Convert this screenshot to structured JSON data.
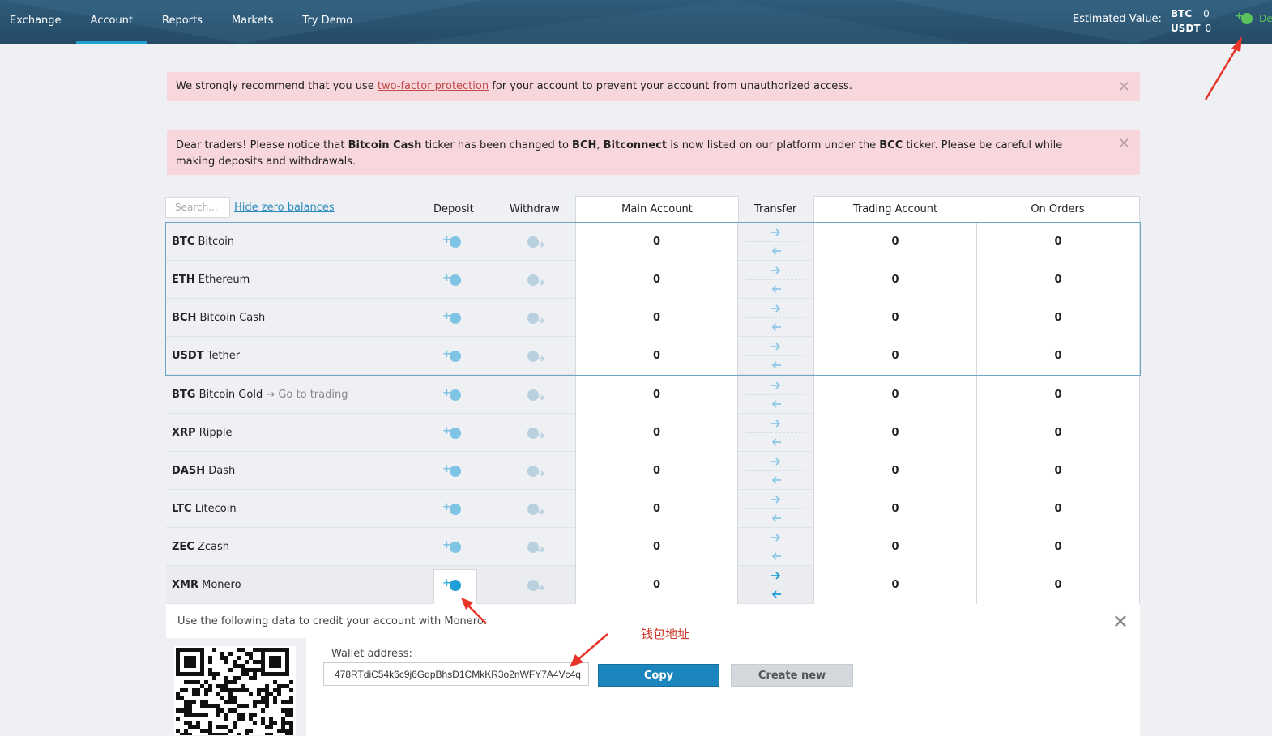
{
  "nav": {
    "items": [
      {
        "label": "Exchange",
        "active": false
      },
      {
        "label": "Account",
        "active": true
      },
      {
        "label": "Reports",
        "active": false
      },
      {
        "label": "Markets",
        "active": false
      },
      {
        "label": "Try Demo",
        "active": false
      }
    ],
    "estimated_label": "Estimated Value:",
    "btc_label": "BTC",
    "btc_value": "0",
    "usdt_label": "USDT",
    "usdt_value": "0",
    "deposit_partial": "De"
  },
  "alerts": {
    "a1_before": "We strongly recommend that you use ",
    "a1_link": "two-factor protection",
    "a1_after": " for your account to prevent your account from unauthorized access.",
    "a2_p1": "Dear traders! Please notice that ",
    "a2_b1": "Bitcoin Cash",
    "a2_p2": " ticker has been changed to ",
    "a2_b2": "BCH",
    "a2_p3": ", ",
    "a2_b3": "Bitconnect",
    "a2_p4": " is now listed on our platform under the ",
    "a2_b4": "BCC",
    "a2_p5": " ticker. Please be careful while making deposits and withdrawals.",
    "close": "✕"
  },
  "table": {
    "search_placeholder": "Search...",
    "hide_zero": "Hide zero balances",
    "headers": {
      "deposit": "Deposit",
      "withdraw": "Withdraw",
      "main": "Main Account",
      "transfer": "Transfer",
      "trading": "Trading Account",
      "orders": "On Orders"
    },
    "rows": [
      {
        "ticker": "BTC",
        "name": "Bitcoin",
        "extra": "",
        "main": "0",
        "trading": "0",
        "orders": "0"
      },
      {
        "ticker": "ETH",
        "name": "Ethereum",
        "extra": "",
        "main": "0",
        "trading": "0",
        "orders": "0"
      },
      {
        "ticker": "BCH",
        "name": "Bitcoin Cash",
        "extra": "",
        "main": "0",
        "trading": "0",
        "orders": "0"
      },
      {
        "ticker": "USDT",
        "name": "Tether",
        "extra": "",
        "main": "0",
        "trading": "0",
        "orders": "0"
      },
      {
        "ticker": "BTG",
        "name": "Bitcoin Gold",
        "extra": " → Go to trading",
        "main": "0",
        "trading": "0",
        "orders": "0"
      },
      {
        "ticker": "XRP",
        "name": "Ripple",
        "extra": "",
        "main": "0",
        "trading": "0",
        "orders": "0"
      },
      {
        "ticker": "DASH",
        "name": "Dash",
        "extra": "",
        "main": "0",
        "trading": "0",
        "orders": "0"
      },
      {
        "ticker": "LTC",
        "name": "Litecoin",
        "extra": "",
        "main": "0",
        "trading": "0",
        "orders": "0"
      },
      {
        "ticker": "ZEC",
        "name": "Zcash",
        "extra": "",
        "main": "0",
        "trading": "0",
        "orders": "0"
      },
      {
        "ticker": "XMR",
        "name": "Monero",
        "extra": "",
        "main": "0",
        "trading": "0",
        "orders": "0"
      }
    ]
  },
  "deposit_panel": {
    "title": "Use the following data to credit your account with Monero:",
    "wallet_label": "Wallet address:",
    "wallet_address": "478RTdiC54k6c9j6GdpBhsD1CMkKR3o2nWFY7A4Vc4q",
    "copy": "Copy",
    "create_new": "Create new",
    "close": "✕"
  },
  "annotation": {
    "text": "钱包地址"
  },
  "colors": {
    "nav_bg": "#244b66",
    "accent": "#21a0d2",
    "alert_bg": "#f8d7dc",
    "copy_btn": "#1a86bd",
    "deposit_icon": "#3ab4e0",
    "annotation": "#d03a2a"
  }
}
